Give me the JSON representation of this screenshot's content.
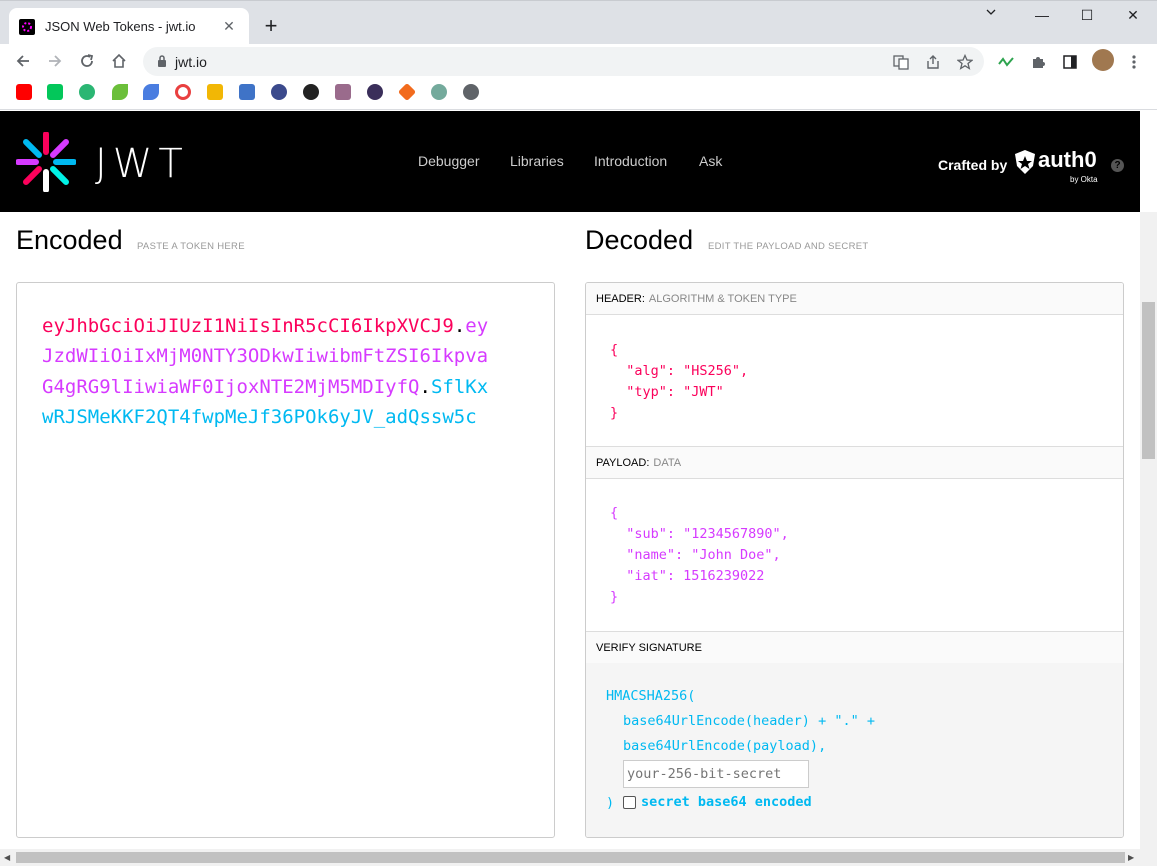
{
  "browser": {
    "tab_title": "JSON Web Tokens - jwt.io",
    "url": "jwt.io",
    "new_tab": "+",
    "tab_close": "✕",
    "win_minimize": "—",
    "win_maximize": "☐",
    "win_close": "✕"
  },
  "site": {
    "logo_text": "JWT",
    "nav": [
      "Debugger",
      "Libraries",
      "Introduction",
      "Ask"
    ],
    "crafted_by": "Crafted by",
    "auth0": "auth0",
    "by_okta": "by Okta",
    "help": "?"
  },
  "encoded": {
    "title": "Encoded",
    "subtitle": "PASTE A TOKEN HERE",
    "header_part": "eyJhbGciOiJIUzI1NiIsInR5cCI6IkpXVCJ9",
    "payload_part": "eyJzdWIiOiIxMjM0NTY3ODkwIiwibmFtZSI6IkpvaG4gRG9lIiwiaWF0IjoxNTE2MjM5MDIyfQ",
    "signature_part": "SflKxwRJSMeKKF2QT4fwpMeJf36POk6yJV_adQssw5c",
    "dot": "."
  },
  "decoded": {
    "title": "Decoded",
    "subtitle": "EDIT THE PAYLOAD AND SECRET",
    "header_label": "HEADER:",
    "header_sub": "ALGORITHM & TOKEN TYPE",
    "header_json": "{\n  \"alg\": \"HS256\",\n  \"typ\": \"JWT\"\n}",
    "payload_label": "PAYLOAD:",
    "payload_sub": "DATA",
    "payload_json": "{\n  \"sub\": \"1234567890\",\n  \"name\": \"John Doe\",\n  \"iat\": 1516239022\n}",
    "verify_label": "VERIFY SIGNATURE",
    "hmac_open": "HMACSHA256(",
    "line1": "base64UrlEncode(header) + \".\" +",
    "line2": "base64UrlEncode(payload),",
    "secret_placeholder": "your-256-bit-secret",
    "close_paren": ")",
    "base64_label": "secret base64 encoded"
  },
  "colors": {
    "header": "#fb015b",
    "payload": "#d63aff",
    "signature": "#00b9f1"
  }
}
